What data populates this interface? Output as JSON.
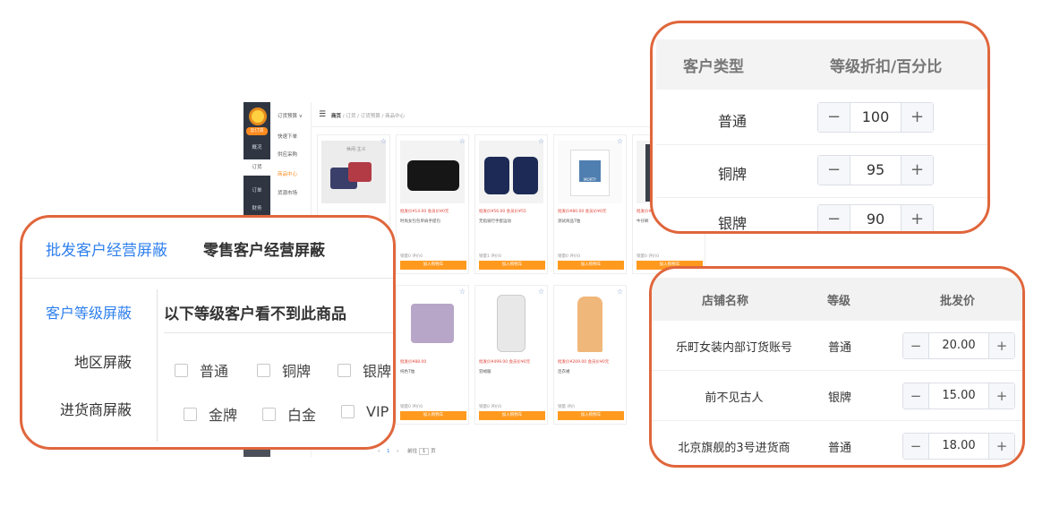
{
  "app": {
    "sidebar": {
      "badge": "云订货",
      "items": [
        "概况",
        "订货",
        "订单",
        "财务"
      ]
    },
    "submenu": {
      "header": "订货预算 ∨",
      "items": [
        "快速下单",
        "供应采购",
        "商品中心",
        "货源市场"
      ]
    },
    "breadcrumb": {
      "menu_icon": "☰",
      "home": "商页",
      "trail": " / 订货 / 订货预算 / 商品中心"
    },
    "product_cards": [
      {
        "price": "",
        "name": "",
        "sales": "",
        "button": "",
        "img_label": "休闲·主义"
      },
      {
        "price": "批发价¥14.00   会员价¥0元",
        "name": "时尚女包包单肩手提包",
        "sales": "销量0   评价0",
        "button": "加入购物车",
        "img_label": ""
      },
      {
        "price": "批发价¥56.00   会员价¥55",
        "name": "无指骑行手套运动",
        "sales": "销量1   评价0",
        "button": "加入购物车",
        "img_label": ""
      },
      {
        "price": "批发价¥80.00   会员价¥0元",
        "name": "测试商品T恤",
        "sales": "销量0   评价0",
        "button": "加入购物车",
        "img_label": "MORTY"
      },
      {
        "price": "批发价¥",
        "name": "牛仔裤",
        "sales": "销量0   评价0",
        "button": "加入购物车",
        "img_label": ""
      },
      {
        "price": "批发价¥88.00",
        "name": "纯色T恤",
        "sales": "销量0   评价0",
        "button": "加入购物车",
        "img_label": ""
      },
      {
        "price": "批发价¥499.00   会员价¥0元",
        "name": "羽绒服",
        "sales": "销量0   评价0",
        "button": "加入购物车",
        "img_label": ""
      },
      {
        "price": "批发价¥209.00   会员价¥0元",
        "name": "连衣裙",
        "sales": "销量   评价",
        "button": "加入购物车",
        "img_label": ""
      }
    ],
    "pager": {
      "prev": "‹",
      "page": "1",
      "next": "›",
      "goto": "前往",
      "page_box": "1",
      "unit": "页"
    }
  },
  "level_discount": {
    "headers": [
      "客户类型",
      "等级折扣/百分比"
    ],
    "rows": [
      {
        "level": "普通",
        "value": "100"
      },
      {
        "level": "铜牌",
        "value": "95"
      },
      {
        "level": "银牌",
        "value": "90"
      }
    ],
    "minus": "−",
    "plus": "+"
  },
  "shielding": {
    "tabs": [
      "批发客户经营屏蔽",
      "零售客户经营屏蔽"
    ],
    "side_items": [
      "客户等级屏蔽",
      "地区屏蔽",
      "进货商屏蔽"
    ],
    "heading": "以下等级客户看不到此商品",
    "levels": [
      "普通",
      "铜牌",
      "银牌",
      "金牌",
      "白金",
      "VIP"
    ]
  },
  "wholesale_price": {
    "headers": [
      "店铺名称",
      "等级",
      "批发价"
    ],
    "rows": [
      {
        "store": "乐町女装内部订货账号",
        "level": "普通",
        "price": "20.00"
      },
      {
        "store": "前不见古人",
        "level": "银牌",
        "price": "15.00"
      },
      {
        "store": "北京旗舰的3号进货商",
        "level": "普通",
        "price": "18.00"
      }
    ],
    "minus": "−",
    "plus": "+"
  },
  "colors": {
    "accent_orange": "#e0663c",
    "link_blue": "#2f80ed",
    "cart_button": "#ff9a1f",
    "sidebar_dark": "#2f3642"
  }
}
